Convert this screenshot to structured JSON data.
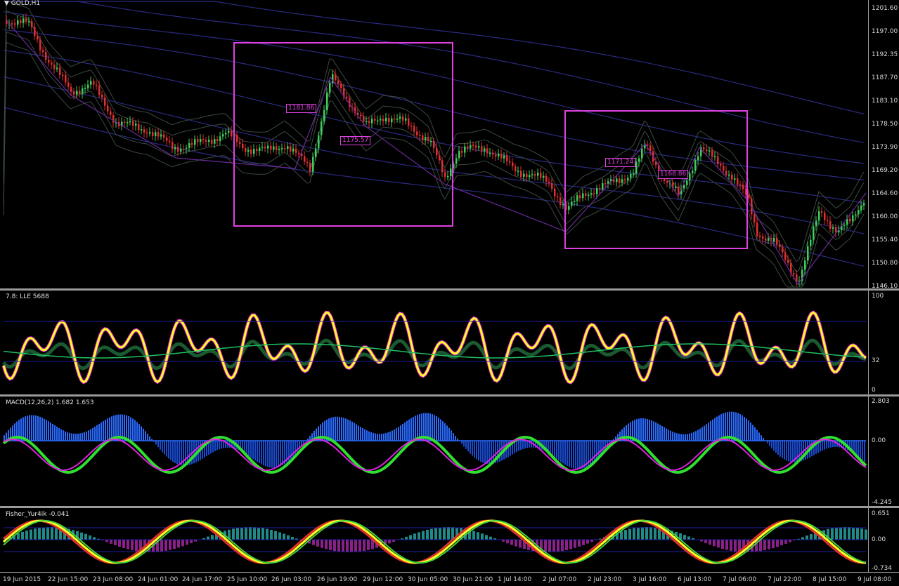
{
  "symbol": {
    "title": "GOLD,H1"
  },
  "colors": {
    "box": "#e040e0",
    "candle_up": "#3ecf5a",
    "candle_down": "#e03030",
    "fast_line": "#ffff20",
    "slow_line": "#20c060",
    "band": "#2a2a80"
  },
  "price_axis": [
    "1201.60",
    "1197.00",
    "1192.35",
    "1187.70",
    "1183.10",
    "1178.50",
    "1173.90",
    "1169.20",
    "1164.60",
    "1160.00",
    "1155.40",
    "1150.80",
    "1146.10"
  ],
  "price_tags": [
    "1181.86",
    "1175.57",
    "1171.24",
    "1168.86"
  ],
  "panel2": {
    "title": "7.8: LLE 5688",
    "axis": [
      "100",
      "32",
      "0"
    ]
  },
  "panel3": {
    "title": "MACD(12,26,2) 1.682 1.653",
    "axis": [
      "2.803",
      "0.00",
      "-4.245"
    ]
  },
  "panel4": {
    "title": "Fisher_Yur4ik -0.041",
    "axis": [
      "0.651",
      "0.00",
      "-0.734"
    ]
  },
  "time_axis": [
    "19 Jun 2015",
    "22 Jun 15:00",
    "23 Jun 08:00",
    "24 Jun 01:00",
    "24 Jun 17:00",
    "25 Jun 10:00",
    "26 Jun 03:00",
    "26 Jun 19:00",
    "29 Jun 12:00",
    "30 Jun 05:00",
    "30 Jun 21:00",
    "1 Jul 14:00",
    "2 Jul 07:00",
    "2 Jul 23:00",
    "3 Jul 16:00",
    "6 Jul 13:00",
    "7 Jul 06:00",
    "7 Jul 22:00",
    "8 Jul 15:00",
    "9 Jul 08:00"
  ]
}
